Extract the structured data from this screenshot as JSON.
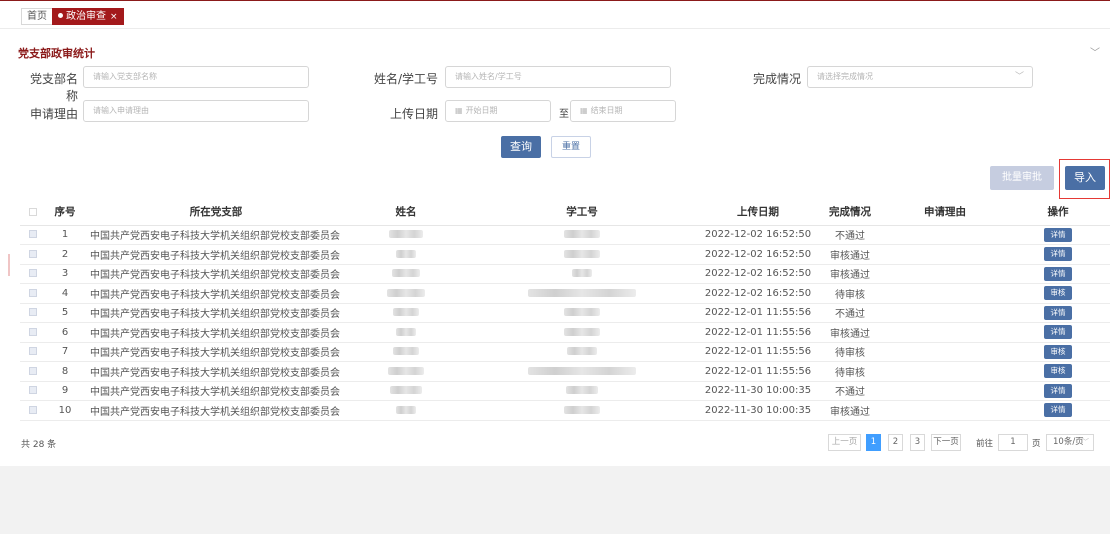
{
  "tabs": {
    "home": "首页",
    "active": "政治审查",
    "close": "×"
  },
  "section_title": "党支部政审统计",
  "filters": {
    "branch_label": "党支部名称",
    "branch_placeholder": "请输入党支部名称",
    "name_label": "姓名/学工号",
    "name_placeholder": "请输入姓名/学工号",
    "status_label": "完成情况",
    "status_placeholder": "请选择完成情况",
    "reason_label": "申请理由",
    "reason_placeholder": "请输入申请理由",
    "date_label": "上传日期",
    "start_placeholder": "开始日期",
    "date_sep": "至",
    "end_placeholder": "结束日期"
  },
  "buttons": {
    "query": "查询",
    "reset": "重置",
    "batch": "批量审批",
    "import": "导入"
  },
  "columns": [
    "序号",
    "所在党支部",
    "姓名",
    "学工号",
    "上传日期",
    "完成情况",
    "申请理由",
    "操作"
  ],
  "rows": [
    {
      "no": "1",
      "dept": "中国共产党西安电子科技大学机关组织部党校支部委员会",
      "date": "2022-12-02 16:52:50",
      "status": "不通过",
      "op": "详情"
    },
    {
      "no": "2",
      "dept": "中国共产党西安电子科技大学机关组织部党校支部委员会",
      "date": "2022-12-02 16:52:50",
      "status": "审核通过",
      "op": "详情"
    },
    {
      "no": "3",
      "dept": "中国共产党西安电子科技大学机关组织部党校支部委员会",
      "date": "2022-12-02 16:52:50",
      "status": "审核通过",
      "op": "详情"
    },
    {
      "no": "4",
      "dept": "中国共产党西安电子科技大学机关组织部党校支部委员会",
      "date": "2022-12-02 16:52:50",
      "status": "待审核",
      "op": "审核"
    },
    {
      "no": "5",
      "dept": "中国共产党西安电子科技大学机关组织部党校支部委员会",
      "date": "2022-12-01 11:55:56",
      "status": "不通过",
      "op": "详情"
    },
    {
      "no": "6",
      "dept": "中国共产党西安电子科技大学机关组织部党校支部委员会",
      "date": "2022-12-01 11:55:56",
      "status": "审核通过",
      "op": "详情"
    },
    {
      "no": "7",
      "dept": "中国共产党西安电子科技大学机关组织部党校支部委员会",
      "date": "2022-12-01 11:55:56",
      "status": "待审核",
      "op": "审核"
    },
    {
      "no": "8",
      "dept": "中国共产党西安电子科技大学机关组织部党校支部委员会",
      "date": "2022-12-01 11:55:56",
      "status": "待审核",
      "op": "审核"
    },
    {
      "no": "9",
      "dept": "中国共产党西安电子科技大学机关组织部党校支部委员会",
      "date": "2022-11-30 10:00:35",
      "status": "不通过",
      "op": "详情"
    },
    {
      "no": "10",
      "dept": "中国共产党西安电子科技大学机关组织部党校支部委员会",
      "date": "2022-11-30 10:00:35",
      "status": "审核通过",
      "op": "详情"
    }
  ],
  "pagination": {
    "total": "共 28 条",
    "prev": "上一页",
    "pages": [
      "1",
      "2",
      "3"
    ],
    "next": "下一页",
    "goto": "前往",
    "goto_value": "1",
    "page_unit": "页",
    "page_size": "10条/页"
  }
}
